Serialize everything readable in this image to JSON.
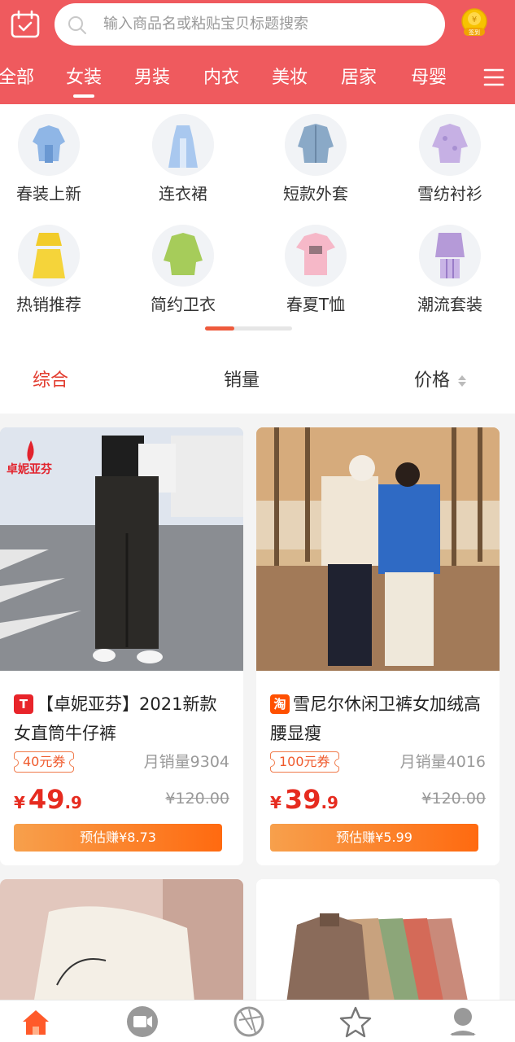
{
  "search": {
    "placeholder": "输入商品名或粘贴宝贝标题搜索"
  },
  "header": {
    "coin_label": "签到"
  },
  "categories": [
    {
      "label": "全部"
    },
    {
      "label": "女装"
    },
    {
      "label": "男装"
    },
    {
      "label": "内衣"
    },
    {
      "label": "美妆"
    },
    {
      "label": "居家"
    },
    {
      "label": "母婴"
    }
  ],
  "subcategories": [
    {
      "label": "春装上新"
    },
    {
      "label": "连衣裙"
    },
    {
      "label": "短款外套"
    },
    {
      "label": "雪纺衬衫"
    },
    {
      "label": "热销推荐"
    },
    {
      "label": "简约卫衣"
    },
    {
      "label": "春夏T恤"
    },
    {
      "label": "潮流套装"
    }
  ],
  "sort": {
    "comprehensive": "综合",
    "sales": "销量",
    "price": "价格"
  },
  "products": [
    {
      "source_badge": "T",
      "badge_color": "#e8242a",
      "title": "【卓妮亚芬】2021新款女直筒牛仔裤",
      "shop_watermark": "卓妮亚芬",
      "coupon": "40元券",
      "monthly_sales": "月销量9304",
      "currency": "¥",
      "price_int": "49",
      "price_dec": ".9",
      "original_price": "¥120.00",
      "earn": "预估赚¥8.73"
    },
    {
      "source_badge": "淘",
      "badge_color": "#ff5000",
      "title": "雪尼尔休闲卫裤女加绒高腰显瘦",
      "coupon": "100元券",
      "monthly_sales": "月销量4016",
      "currency": "¥",
      "price_int": "39",
      "price_dec": ".9",
      "original_price": "¥120.00",
      "earn": "预估赚¥5.99"
    }
  ],
  "colors": {
    "header": "#ef5a5e",
    "price": "#e62b1f",
    "active_sort": "#e23b2e",
    "earn_gradient_end": "#ff6a10"
  }
}
